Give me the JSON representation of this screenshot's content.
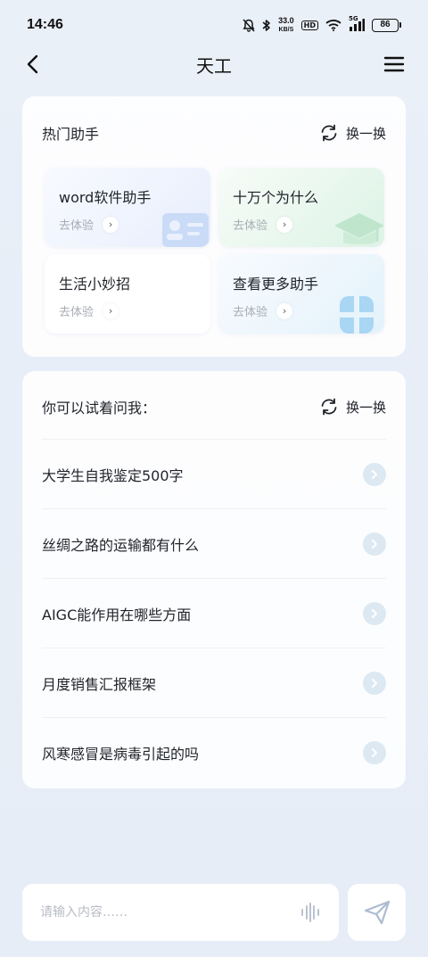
{
  "status_bar": {
    "time": "14:46",
    "net_speed_value": "33.0",
    "net_speed_unit": "KB/S",
    "hd_label": "HD",
    "signal_label": "5G",
    "battery": "86"
  },
  "nav": {
    "title": "天工"
  },
  "hot_assistants": {
    "title": "热门助手",
    "refresh_label": "换一换",
    "tiles": [
      {
        "name": "word软件助手",
        "action": "去体验"
      },
      {
        "name": "十万个为什么",
        "action": "去体验"
      },
      {
        "name": "生活小妙招",
        "action": "去体验"
      },
      {
        "name": "查看更多助手",
        "action": "去体验"
      }
    ]
  },
  "suggestions": {
    "title": "你可以试着问我：",
    "refresh_label": "换一换",
    "items": [
      "大学生自我鉴定500字",
      "丝绸之路的运输都有什么",
      "AIGC能作用在哪些方面",
      "月度销售汇报框架",
      "风寒感冒是病毒引起的吗"
    ]
  },
  "composer": {
    "placeholder": "请输入内容……"
  },
  "colors": {
    "background": "#e8eef7",
    "card": "#ffffff",
    "arrow_circle": "#dce9f3",
    "send_icon": "#aebcd0"
  }
}
